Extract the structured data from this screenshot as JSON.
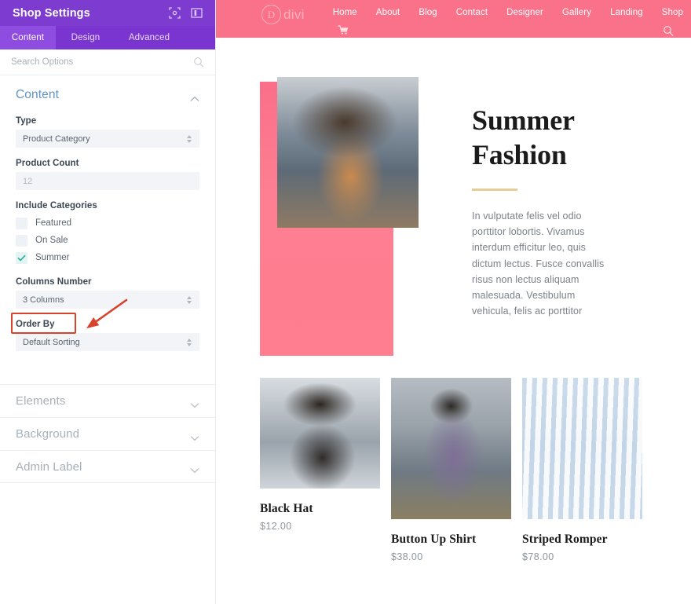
{
  "panel": {
    "title": "Shop Settings",
    "header_icons": [
      {
        "name": "fullscreen-icon"
      },
      {
        "name": "panel-layout-icon"
      }
    ],
    "tabs": [
      {
        "label": "Content",
        "active": true
      },
      {
        "label": "Design",
        "active": false
      },
      {
        "label": "Advanced",
        "active": false
      }
    ],
    "search": {
      "placeholder": "Search Options",
      "value": "",
      "icon": "search-icon"
    },
    "section": {
      "title": "Content",
      "expanded": true,
      "fields": {
        "type": {
          "label": "Type",
          "value": "Product Category"
        },
        "product_count": {
          "label": "Product Count",
          "value": "12",
          "is_placeholder": true
        },
        "include_categories": {
          "label": "Include Categories",
          "options": [
            {
              "label": "Featured",
              "checked": false
            },
            {
              "label": "On Sale",
              "checked": false
            },
            {
              "label": "Summer",
              "checked": true,
              "highlighted": true
            }
          ]
        },
        "columns_number": {
          "label": "Columns Number",
          "value": "3 Columns"
        },
        "order_by": {
          "label": "Order By",
          "value": "Default Sorting"
        }
      }
    },
    "collapsed_sections": [
      {
        "label": "Elements"
      },
      {
        "label": "Background"
      },
      {
        "label": "Admin Label"
      }
    ],
    "colors": {
      "header_purple": "#7e3bd0",
      "tab_bar_purple": "#7a34cf",
      "tab_active_purple": "#8f4ce0",
      "section_title_blue": "#5f93c4",
      "highlight_red": "#d9422b",
      "check_teal": "#2aab9a"
    }
  },
  "preview": {
    "nav": {
      "logo_mark": "D",
      "logo_text": "divi",
      "menu": [
        {
          "label": "Home"
        },
        {
          "label": "About"
        },
        {
          "label": "Blog"
        },
        {
          "label": "Contact"
        },
        {
          "label": "Designer"
        },
        {
          "label": "Gallery"
        },
        {
          "label": "Landing"
        },
        {
          "label": "Shop"
        }
      ],
      "cart_icon": "cart-icon",
      "search_icon": "search-icon",
      "bg_color": "#fa7289"
    },
    "hero": {
      "heading_line1": "Summer",
      "heading_line2": "Fashion",
      "body": "In vulputate felis vel odio porttitor lobortis. Vivamus interdum efficitur leo, quis dictum lectus. Fusce convallis risus non lectus aliquam malesuada. Vestibulum vehicula, felis ac porttitor",
      "rule_color": "#e5cd93",
      "pink_block_color": "#fa6f89"
    },
    "products": [
      {
        "title": "Black Hat",
        "price": "$12.00"
      },
      {
        "title": "Button Up Shirt",
        "price": "$38.00"
      },
      {
        "title": "Striped Romper",
        "price": "$78.00"
      }
    ]
  }
}
